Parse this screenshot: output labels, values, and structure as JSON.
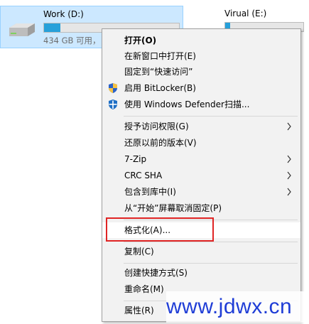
{
  "drives": [
    {
      "name": "Work (D:)",
      "free_text": "434 GB 可用，",
      "used_fraction": 0.12,
      "selected": true
    },
    {
      "name": "Virual (E:)",
      "used_fraction": 0.06,
      "selected": false
    }
  ],
  "menu": {
    "items": [
      {
        "label": "打开(O)",
        "bold": true
      },
      {
        "label": "在新窗口中打开(E)"
      },
      {
        "label": "固定到“快速访问”"
      },
      {
        "label": "启用 BitLocker(B)",
        "icon": "bitlocker-shield-icon"
      },
      {
        "label": "使用 Windows Defender扫描...",
        "icon": "defender-shield-icon"
      },
      {
        "label": "授予访问权限(G)",
        "submenu": true
      },
      {
        "label": "还原以前的版本(V)"
      },
      {
        "label": "7-Zip",
        "submenu": true
      },
      {
        "label": "CRC SHA",
        "submenu": true
      },
      {
        "label": "包含到库中(I)",
        "submenu": true
      },
      {
        "label": "从“开始”屏幕取消固定(P)"
      },
      {
        "label": "格式化(A)...",
        "highlighted": true
      },
      {
        "label": "复制(C)"
      },
      {
        "label": "创建快捷方式(S)"
      },
      {
        "label": "重命名(M)"
      },
      {
        "label": "属性(R)"
      }
    ]
  },
  "watermark": "www.jdwx.cn",
  "colors": {
    "selection": "#cce8ff",
    "bar_fill": "#26a0da",
    "highlight_border": "#e02424",
    "watermark": "#1f3dd6"
  }
}
